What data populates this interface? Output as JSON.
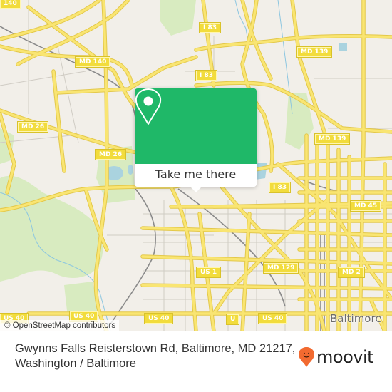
{
  "map": {
    "colors": {
      "background": "#f2efe9",
      "road_major": "#f7e26b",
      "road_casing": "#e8cc4a",
      "road_minor": "#ffffff",
      "park": "#d8ebc0",
      "water": "#aad3df",
      "rail": "#888888",
      "shield_bg": "#f2dc3c"
    },
    "road_labels": [
      {
        "id": "md140-topleft",
        "text": "140"
      },
      {
        "id": "md140",
        "text": "MD 140"
      },
      {
        "id": "md26-left",
        "text": "MD 26"
      },
      {
        "id": "md26-center",
        "text": "MD 26"
      },
      {
        "id": "i83-top",
        "text": "I 83"
      },
      {
        "id": "i83-mid",
        "text": "I 83"
      },
      {
        "id": "i83-lower",
        "text": "I 83"
      },
      {
        "id": "md139-top",
        "text": "MD 139"
      },
      {
        "id": "md139-mid",
        "text": "MD 139"
      },
      {
        "id": "md45",
        "text": "MD 45"
      },
      {
        "id": "us1",
        "text": "US 1"
      },
      {
        "id": "md129",
        "text": "MD 129"
      },
      {
        "id": "md2",
        "text": "MD 2"
      },
      {
        "id": "us40-left",
        "text": "US 40"
      },
      {
        "id": "us40-midleft",
        "text": "US 40"
      },
      {
        "id": "us40-mid",
        "text": "US 40"
      },
      {
        "id": "us40-partial",
        "text": "U"
      },
      {
        "id": "us40-right",
        "text": "US 40"
      }
    ],
    "city_label": "Baltimore",
    "attribution": "© OpenStreetMap contributors"
  },
  "popup": {
    "icon": "map-pin-icon",
    "button_label": "Take me there",
    "color": "#1fb868"
  },
  "footer": {
    "address": "Gwynns Falls Reisterstown Rd, Baltimore, MD 21217, Washington / Baltimore",
    "brand": "moovit",
    "brand_icon": "moovit-pin-icon",
    "brand_color": "#f26a30"
  }
}
